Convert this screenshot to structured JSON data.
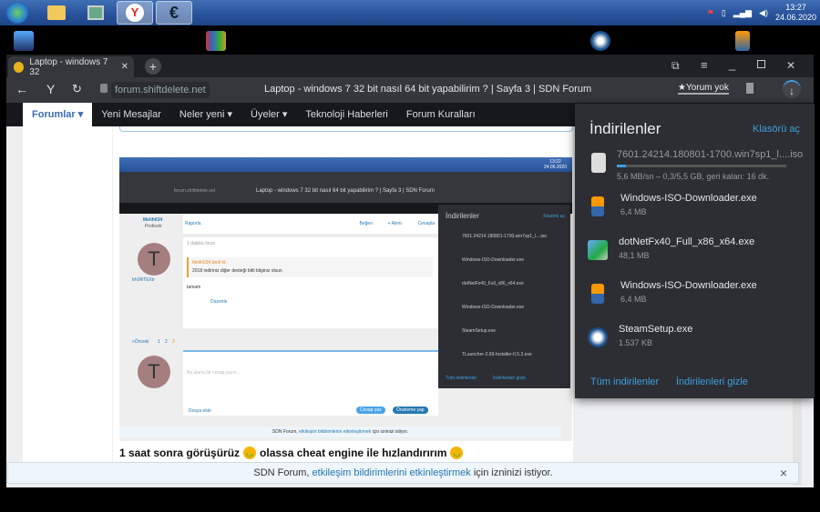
{
  "taskbar": {
    "time": "13:27",
    "date": "24.06.2020"
  },
  "browser": {
    "tab_title": "Laptop - windows 7 32",
    "url": "forum.shiftdelete.net",
    "page_title": "Laptop - windows 7 32 bit nasıl 64 bit yapabilirim ? | Sayfa 3 | SDN Forum",
    "yorum": "★Yorum yok"
  },
  "nav": {
    "items": [
      {
        "label": "Forumlar ▾"
      },
      {
        "label": "Yeni Mesajlar"
      },
      {
        "label": "Neler yeni ▾"
      },
      {
        "label": "Üyeler ▾"
      },
      {
        "label": "Teknoloji Haberleri"
      },
      {
        "label": "Forum Kuralları"
      }
    ]
  },
  "embedded": {
    "time": "13:22",
    "date": "24.06.2020",
    "user1": "Melih034",
    "user1_role": "Profesör",
    "report": "Raporla",
    "like": "Beğen",
    "quote": "+ Alıntı",
    "reply": "Cevapla",
    "ago": "1 dakika önce",
    "quoter": "Melih034 dedi ki:",
    "quote_text": "2018 indiriniz diğer desteği bitti bilginiz olsun",
    "answer": "tamam",
    "edit": "Düzenle",
    "user2": "trh0RTEXtr",
    "prev": "«Önceki",
    "pages": [
      "1",
      "2",
      "3"
    ],
    "placeholder": "Bu alana bir cevap yazın...",
    "attach": "Dosya ekle",
    "send": "Cevap yaz",
    "preview": "Önizleme yap",
    "dl_title": "İndirilenler",
    "dl_folder": "Klasörü aç",
    "dl_items": [
      "7601.24214.180801-1700.win7sp1_l....iso",
      "Windows-ISO-Downloader.exe",
      "dotNetFx40_Full_x86_x64.exe",
      "Windows-ISO-Downloader.exe",
      "SteamSetup.exe",
      "TLauncher-2.69-Installer-0.5.2.exe"
    ],
    "dl_all": "Tüm indirilenler",
    "dl_hide": "İndirilenleri gizle"
  },
  "post": {
    "text1": "1 saat sonra görüşürüz",
    "text2": "olassa cheat engine ile hızlandırırım"
  },
  "notification": {
    "prefix": "SDN Forum,",
    "link": "etkileşim bildirimlerini etkinleştirmek",
    "suffix": "için izninizi istiyor.",
    "close": "×"
  },
  "downloads": {
    "title": "İndirilenler",
    "open_folder": "Klasörü aç",
    "active": {
      "name": "7601.24214.180801-1700.win7sp1_l....iso",
      "status": "5,6 MB/sn – 0,3/5,5 GB, geri kalan: 16 dk.",
      "progress": 0.055
    },
    "items": [
      {
        "name": "Windows-ISO-Downloader.exe",
        "size": "6,4 MB",
        "icon": "archive-icon"
      },
      {
        "name": "dotNetFx40_Full_x86_x64.exe",
        "size": "48,1 MB",
        "icon": "installer-icon"
      },
      {
        "name": "Windows-ISO-Downloader.exe",
        "size": "6,4 MB",
        "icon": "archive-icon"
      },
      {
        "name": "SteamSetup.exe",
        "size": "1.537 KB",
        "icon": "steam-icon"
      }
    ],
    "all": "Tüm indirilenler",
    "hide": "İndirilenleri gizle"
  },
  "colors": {
    "accent": "#3f9fe0",
    "taskbar": "#27519a",
    "panel": "#2c2e33"
  }
}
